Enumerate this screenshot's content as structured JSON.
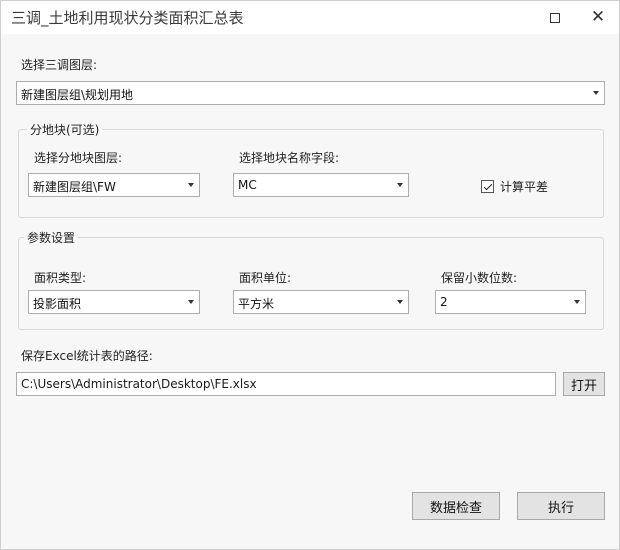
{
  "window": {
    "title": "三调_土地利用现状分类面积汇总表",
    "maximize_icon": "maximize-icon",
    "close_icon": "close-icon",
    "close_glyph": "✕"
  },
  "layer_select": {
    "label": "选择三调图层:",
    "value": "新建图层组\\规划用地"
  },
  "parcel_group": {
    "legend": "分地块(可选)",
    "layer_label": "选择分地块图层:",
    "layer_value": "新建图层组\\FW",
    "field_label": "选择地块名称字段:",
    "field_value": "MC",
    "calc_diff_label": "计算平差",
    "calc_diff_checked": true
  },
  "params_group": {
    "legend": "参数设置",
    "area_type_label": "面积类型:",
    "area_type_value": "投影面积",
    "area_unit_label": "面积单位:",
    "area_unit_value": "平方米",
    "decimals_label": "保留小数位数:",
    "decimals_value": "2"
  },
  "output": {
    "label": "保存Excel统计表的路径:",
    "path_value": "C:\\Users\\Administrator\\Desktop\\FE.xlsx",
    "open_button": "打开"
  },
  "footer": {
    "check_button": "数据检查",
    "run_button": "执行"
  }
}
